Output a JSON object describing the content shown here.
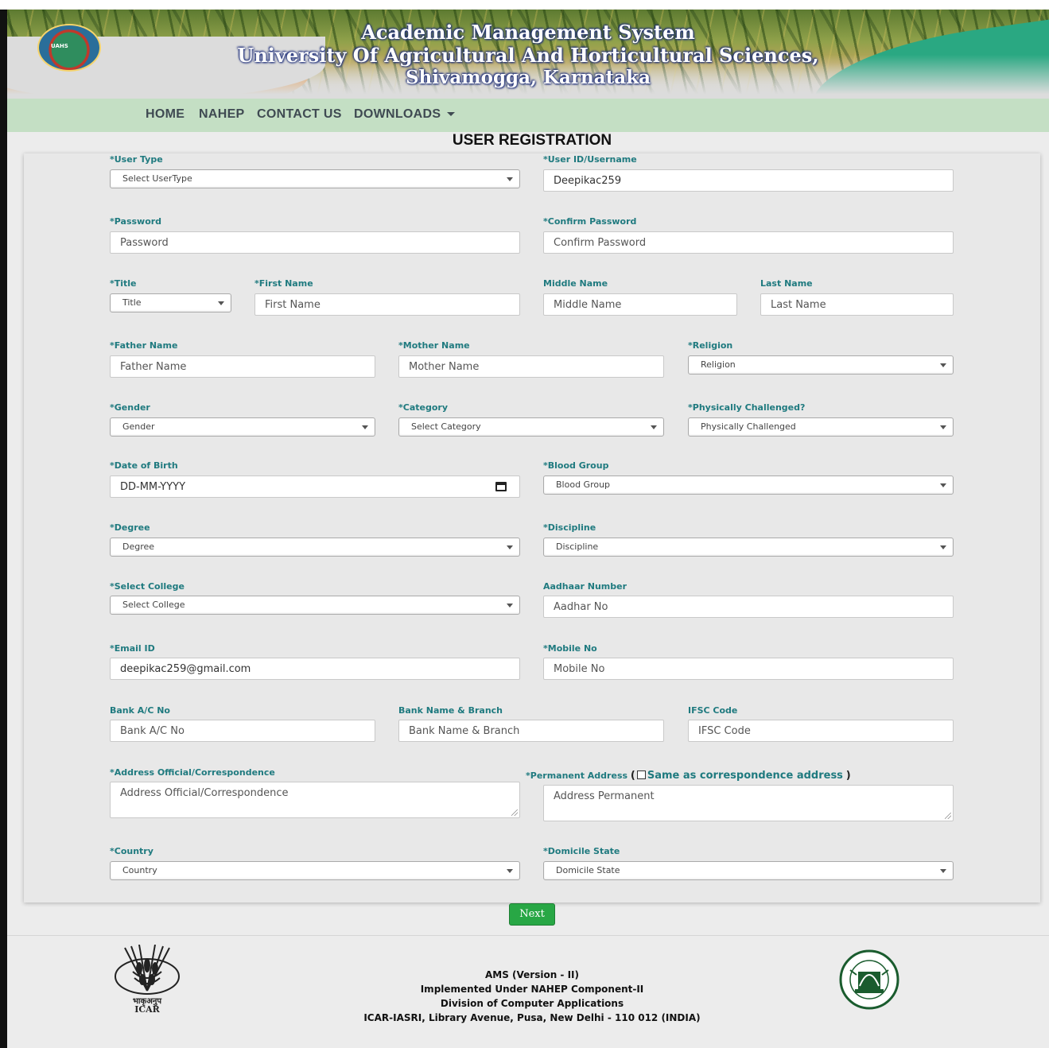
{
  "header": {
    "title_line1": "Academic Management System",
    "title_line2": "University Of Agricultural And Horticultural Sciences,",
    "title_line3": "Shivamogga, Karnataka",
    "logo_text": "UAHS"
  },
  "nav": {
    "home": "HOME",
    "nahep": "NAHEP",
    "contact": "CONTACT US",
    "downloads": "DOWNLOADS"
  },
  "page_heading": "USER REGISTRATION",
  "form": {
    "user_type": {
      "label": "*User Type",
      "value": "Select UserType"
    },
    "username": {
      "label": "*User ID/Username",
      "value": "Deepikac259"
    },
    "password": {
      "label": "*Password",
      "placeholder": "Password"
    },
    "confirm_password": {
      "label": "*Confirm Password",
      "placeholder": "Confirm Password"
    },
    "title": {
      "label": "*Title",
      "value": "Title"
    },
    "first_name": {
      "label": "*First Name",
      "placeholder": "First Name"
    },
    "middle_name": {
      "label": "Middle Name",
      "placeholder": "Middle Name"
    },
    "last_name": {
      "label": "Last Name",
      "placeholder": "Last Name"
    },
    "father_name": {
      "label": "*Father Name",
      "placeholder": "Father Name"
    },
    "mother_name": {
      "label": "*Mother Name",
      "placeholder": "Mother Name"
    },
    "religion": {
      "label": "*Religion",
      "value": "Religion"
    },
    "gender": {
      "label": "*Gender",
      "value": "Gender"
    },
    "category": {
      "label": "*Category",
      "value": "Select Category"
    },
    "physically_challenged": {
      "label": "*Physically Challenged?",
      "value": "Physically Challenged"
    },
    "dob": {
      "label": "*Date of Birth",
      "placeholder": "DD-MM-YYYY"
    },
    "blood_group": {
      "label": "*Blood Group",
      "value": "Blood Group"
    },
    "degree": {
      "label": "*Degree",
      "value": "Degree"
    },
    "discipline": {
      "label": "*Discipline",
      "value": "Discipline"
    },
    "college": {
      "label": "*Select College",
      "value": "Select College"
    },
    "aadhaar": {
      "label": "Aadhaar Number",
      "placeholder": "Aadhar No"
    },
    "email": {
      "label": "*Email ID",
      "value": "deepikac259@gmail.com"
    },
    "mobile": {
      "label": "*Mobile No",
      "placeholder": "Mobile No"
    },
    "bank_ac": {
      "label": "Bank A/C No",
      "placeholder": "Bank A/C No"
    },
    "bank_name": {
      "label": "Bank Name & Branch",
      "placeholder": "Bank Name & Branch"
    },
    "ifsc": {
      "label": "IFSC Code",
      "placeholder": "IFSC Code"
    },
    "address_official": {
      "label": "*Address Official/Correspondence",
      "placeholder": "Address Official/Correspondence"
    },
    "address_permanent": {
      "label": "*Permanent Address",
      "same_label": "Same as correspondence address",
      "placeholder": "Address Permanent",
      "open_paren": "(",
      "close_paren": ")"
    },
    "country": {
      "label": "*Country",
      "value": "Country"
    },
    "domicile": {
      "label": "*Domicile State",
      "value": "Domicile State"
    }
  },
  "next_button": "Next",
  "footer": {
    "line1": "AMS (Version - II)",
    "line2": "Implemented Under NAHEP Component-II",
    "line3": "Division of Computer Applications",
    "line4": "ICAR-IASRI, Library Avenue, Pusa, New Delhi - 110 012 (INDIA)",
    "icar_hindi": "भाकृअनुप",
    "icar_text": "ICAR"
  },
  "colors": {
    "label": "#1f7a7f",
    "nav_bg": "#c4dfc4",
    "next_button": "#28a745",
    "accent_orange": "#e8892b",
    "accent_teal": "#2aa882"
  }
}
